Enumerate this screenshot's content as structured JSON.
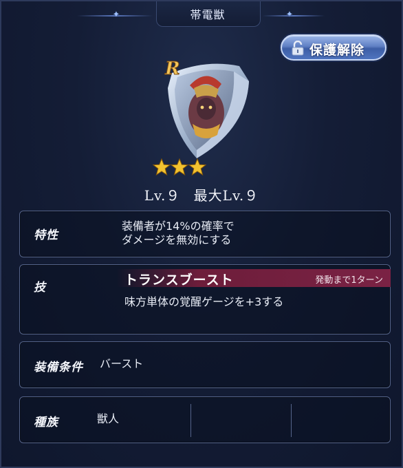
{
  "header": {
    "title": "帯電獣"
  },
  "unlock_button": {
    "label": "保護解除",
    "icon": "padlock-icon"
  },
  "equipment": {
    "rarity_badge": "R",
    "art": "shield-with-beast-warrior",
    "stars": 3,
    "level_label": "Lv.９",
    "max_level_label": "最大Lv.９"
  },
  "trait": {
    "label": "特性",
    "lines": [
      "装備者が14%の確率で",
      "ダメージを無効にする"
    ]
  },
  "skill": {
    "label": "技",
    "name": "トランスブースト",
    "turns": "発動まで1ターン",
    "description": "味方単体の覚醒ゲージを+3する"
  },
  "condition": {
    "label": "装備条件",
    "value": "バースト"
  },
  "race": {
    "label": "種族",
    "value": "獣人"
  },
  "colors": {
    "panel_bg": "#141d36",
    "skill_bar": "#7a2244",
    "button_blue": "#5f7fc4",
    "star_gold": "#f2c230"
  }
}
